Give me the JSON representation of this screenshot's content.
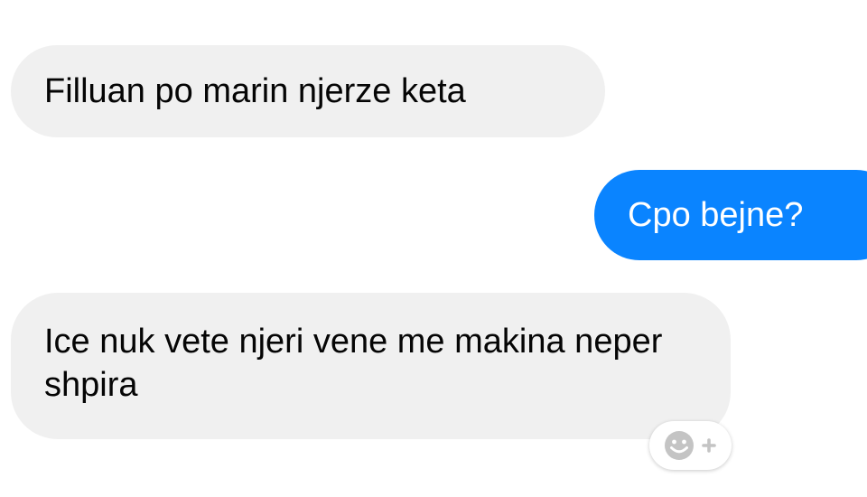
{
  "conversation": {
    "messages": [
      {
        "direction": "incoming",
        "text": "Filluan po marin njerze keta"
      },
      {
        "direction": "outgoing",
        "text": "Cpo bejne?"
      },
      {
        "direction": "incoming",
        "text": "Ice nuk vete njeri vene me makina neper shpira"
      }
    ],
    "reaction_button": {
      "icon": "add-reaction-icon"
    }
  },
  "colors": {
    "incoming_bubble": "#f0f0f0",
    "outgoing_bubble": "#0a84ff",
    "reaction_icon": "#c4c4c4"
  }
}
